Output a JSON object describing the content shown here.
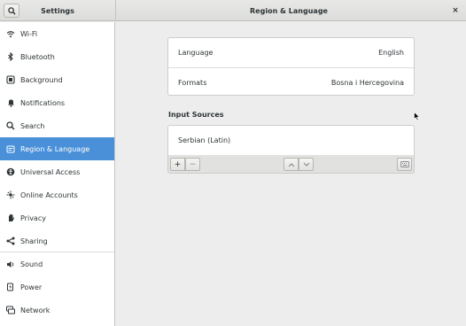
{
  "header": {
    "left_title": "Settings",
    "main_title": "Region & Language",
    "close_label": "×"
  },
  "sidebar": {
    "items": [
      {
        "label": "Wi-Fi",
        "icon": "wifi-icon"
      },
      {
        "label": "Bluetooth",
        "icon": "bluetooth-icon"
      },
      {
        "label": "Background",
        "icon": "background-icon"
      },
      {
        "label": "Notifications",
        "icon": "bell-icon"
      },
      {
        "label": "Search",
        "icon": "search-icon"
      },
      {
        "label": "Region & Language",
        "icon": "flag-icon",
        "active": true
      },
      {
        "label": "Universal Access",
        "icon": "accessibility-icon"
      },
      {
        "label": "Online Accounts",
        "icon": "online-accounts-icon"
      },
      {
        "label": "Privacy",
        "icon": "privacy-hand-icon"
      },
      {
        "label": "Sharing",
        "icon": "share-icon"
      },
      {
        "label": "Sound",
        "icon": "speaker-icon"
      },
      {
        "label": "Power",
        "icon": "power-icon"
      },
      {
        "label": "Network",
        "icon": "network-icon"
      }
    ]
  },
  "region": {
    "language_label": "Language",
    "language_value": "English",
    "formats_label": "Formats",
    "formats_value": "Bosna i Hercegovina"
  },
  "input_sources": {
    "title": "Input Sources",
    "items": [
      "Serbian (Latin)"
    ],
    "add_label": "+",
    "remove_label": "−"
  },
  "colors": {
    "accent": "#4a90d9",
    "sidebar_bg": "#ffffff",
    "content_bg": "#ededed"
  }
}
